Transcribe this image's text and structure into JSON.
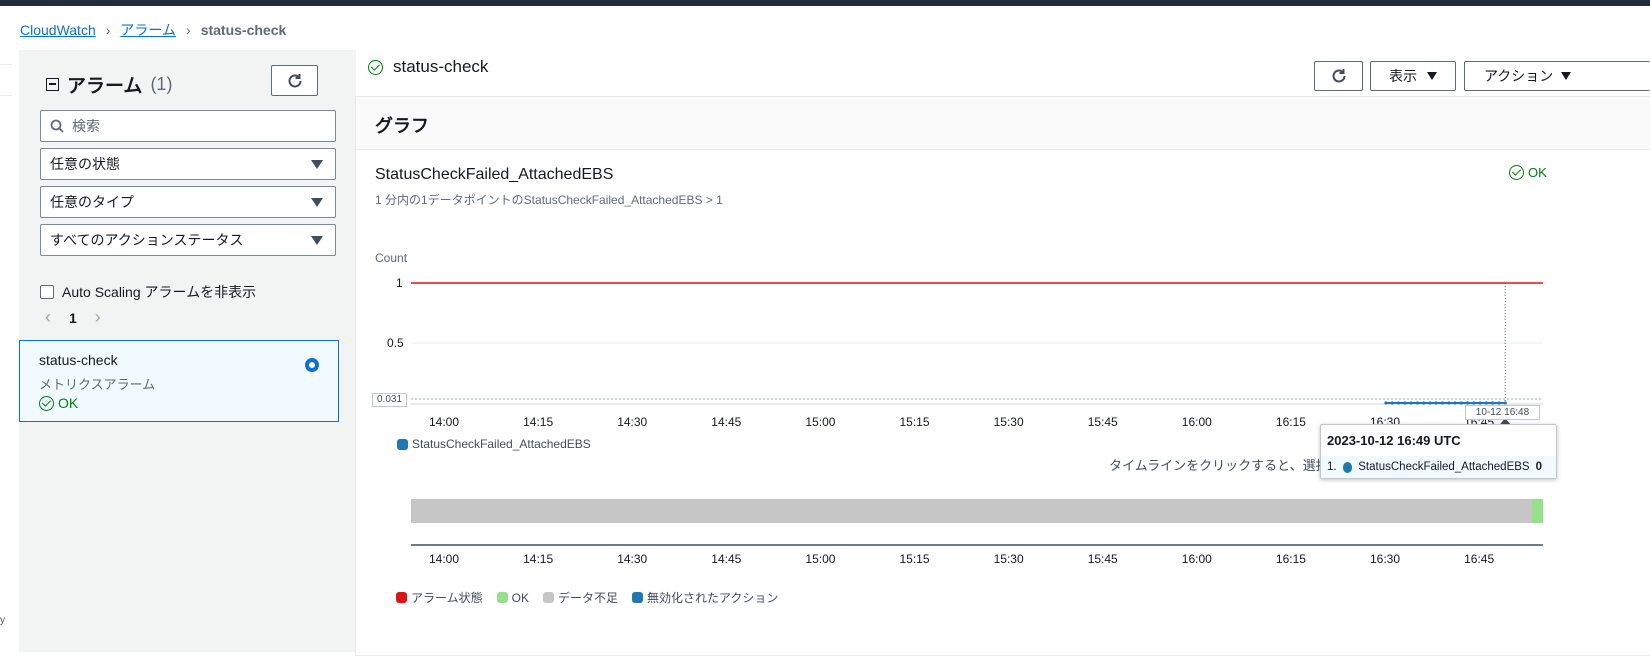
{
  "breadcrumb": {
    "root": "CloudWatch",
    "alarms": "アラーム",
    "current": "status-check"
  },
  "sidebar": {
    "title": "アラーム",
    "count": "(1)",
    "search_placeholder": "検索",
    "filters": [
      "任意の状態",
      "任意のタイプ",
      "すべてのアクションステータス"
    ],
    "hide_autoscaling_label": "Auto Scaling アラームを非表示",
    "page": "1",
    "alarm": {
      "name": "status-check",
      "type": "メトリクスアラーム",
      "state": "OK"
    }
  },
  "header": {
    "title": "status-check",
    "view_button": "表示",
    "actions_button": "アクション"
  },
  "graph": {
    "section_title": "グラフ",
    "metric_title": "StatusCheckFailed_AttachedEBS",
    "condition": "1 分内の1データポイントのStatusCheckFailed_AttachedEBS > 1",
    "state": "OK",
    "hint": "タイムラインをクリックすると、選択した",
    "tooltip": {
      "time": "2023-10-12 16:49 UTC",
      "index": "1.",
      "series": "StatusCheckFailed_AttachedEBS",
      "value": "0"
    },
    "cursor_label": "10-12 16:48",
    "threshold_marker": "0.031",
    "timeline_legend": [
      {
        "label": "アラーム状態",
        "color": "#d91515"
      },
      {
        "label": "OK",
        "color": "#96e08c"
      },
      {
        "label": "データ不足",
        "color": "#c6c6c6"
      },
      {
        "label": "無効化されたアクション",
        "color": "#1f77b4"
      }
    ],
    "colors": {
      "threshold": "#d91515",
      "series": "#1f77b4",
      "timeline_grey": "#c6c6c6",
      "timeline_ok": "#96e08c"
    }
  },
  "chart_data": {
    "type": "line",
    "ylabel": "Count",
    "ylim": [
      0,
      1
    ],
    "y_ticks": [
      "1",
      "0.5"
    ],
    "x_ticks": [
      "14:00",
      "14:15",
      "14:30",
      "14:45",
      "15:00",
      "15:15",
      "15:30",
      "15:45",
      "16:00",
      "16:15",
      "16:30",
      "16:45"
    ],
    "threshold": 1,
    "series": [
      {
        "name": "StatusCheckFailed_AttachedEBS",
        "x_start": "16:30",
        "x_end": "16:49",
        "value": 0
      }
    ]
  }
}
